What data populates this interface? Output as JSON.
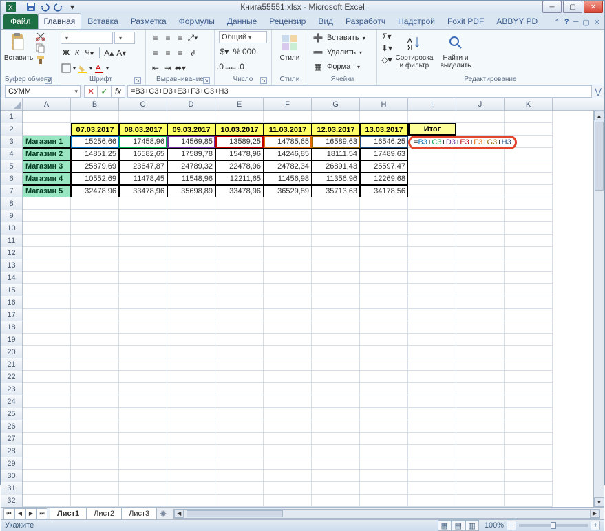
{
  "window": {
    "title": "Книга55551.xlsx - Microsoft Excel"
  },
  "qat": {
    "save_tip": "Сохранить",
    "undo_tip": "Отменить",
    "redo_tip": "Вернуть"
  },
  "tabs": {
    "file": "Файл",
    "items": [
      "Главная",
      "Вставка",
      "Разметка",
      "Формулы",
      "Данные",
      "Рецензир",
      "Вид",
      "Разработч",
      "Надстрой",
      "Foxit PDF",
      "ABBYY PD"
    ],
    "active_index": 0,
    "help_icon": "?"
  },
  "ribbon": {
    "clipboard": {
      "paste": "Вставить",
      "label": "Буфер обмена"
    },
    "font": {
      "name": "",
      "size": "",
      "label": "Шрифт"
    },
    "alignment": {
      "label": "Выравнивание"
    },
    "number": {
      "format": "Общий",
      "label": "Число"
    },
    "styles": {
      "styles_btn": "Стили",
      "label": "Стили"
    },
    "cells": {
      "insert": "Вставить",
      "delete": "Удалить",
      "format": "Формат",
      "label": "Ячейки"
    },
    "editing": {
      "sort": "Сортировка и фильтр",
      "find": "Найти и выделить",
      "label": "Редактирование"
    }
  },
  "formula_bar": {
    "name_box": "СУММ",
    "cancel_tip": "Отмена",
    "enter_tip": "Ввод",
    "fx_tip": "Вставить функцию",
    "formula": "=B3+C3+D3+E3+F3+G3+H3"
  },
  "columns": [
    "A",
    "B",
    "C",
    "D",
    "E",
    "F",
    "G",
    "H",
    "I",
    "J",
    "K"
  ],
  "row_numbers": [
    1,
    2,
    3,
    4,
    5,
    6,
    7,
    8,
    9,
    10,
    11,
    12,
    13,
    14,
    15,
    16,
    17,
    18,
    19,
    20,
    21,
    22,
    23,
    24,
    25,
    26,
    27,
    28,
    29,
    30,
    31,
    32
  ],
  "table": {
    "dates": [
      "07.03.2017",
      "08.03.2017",
      "09.03.2017",
      "10.03.2017",
      "11.03.2017",
      "12.03.2017",
      "13.03.2017"
    ],
    "total_header": "Итог",
    "rows": [
      {
        "name": "Магазин 1",
        "vals": [
          "15256,66",
          "17458,96",
          "14569,85",
          "13589,25",
          "14785,65",
          "16589,63",
          "16546,25"
        ]
      },
      {
        "name": "Магазин 2",
        "vals": [
          "14851,25",
          "16582,65",
          "17589,78",
          "15478,96",
          "14246,85",
          "18111,54",
          "17489,63"
        ]
      },
      {
        "name": "Магазин 3",
        "vals": [
          "25879,69",
          "23647,87",
          "24789,32",
          "22478,96",
          "24782,34",
          "26891,43",
          "25597,47"
        ]
      },
      {
        "name": "Магазин 4",
        "vals": [
          "10552,69",
          "11478,45",
          "11548,96",
          "12211,65",
          "11456,98",
          "11356,96",
          "12269,68"
        ]
      },
      {
        "name": "Магазин 5",
        "vals": [
          "32478,96",
          "33478,96",
          "35698,89",
          "33478,96",
          "36529,89",
          "35713,63",
          "34178,56"
        ]
      }
    ],
    "formula_display": {
      "prefix": "=",
      "tokens": [
        "B3",
        "+",
        "C3",
        "+",
        "D3",
        "+",
        "E3",
        "+",
        "F3",
        "+",
        "G3",
        "+",
        "H3"
      ]
    }
  },
  "sheets": {
    "nav_tip": "",
    "items": [
      "Лист1",
      "Лист2",
      "Лист3"
    ],
    "active_index": 0
  },
  "status": {
    "mode": "Укажите",
    "zoom": "100%"
  }
}
